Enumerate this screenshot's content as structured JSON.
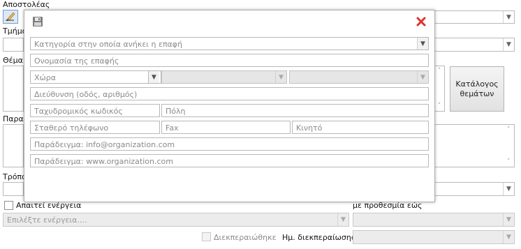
{
  "background_form": {
    "sender_label": "Αποστολέας",
    "department_label": "Τμήμα",
    "subject_label": "Θέμα",
    "notes_label": "Παρατ",
    "method_label": "Τρόπο",
    "catalog_button": "Κατάλογος θεμάτων",
    "requires_action_label": "Απαιτεί ενέργεια",
    "deadline_label": "με προθεσμία εώς",
    "action_select_placeholder": "Επιλέξτε ενέργεια....",
    "completed_label": "Διεκπεραιώθηκε",
    "completion_date_label": "Ημ. διεκπεραίωσης:"
  },
  "modal": {
    "category_placeholder": "Κατηγορία στην οποία ανήκει η επαφή",
    "contact_name_placeholder": "Ονομασία της επαφής",
    "country_placeholder": "Χώρα",
    "address_placeholder": "Διεύθυνση (οδός, αριθμός)",
    "postal_code_placeholder": "Ταχυδρομικός κωδικός",
    "city_placeholder": "Πόλη",
    "phone_placeholder": "Σταθερό τηλέφωνο",
    "fax_placeholder": "Fax",
    "mobile_placeholder": "Κινητό",
    "email_placeholder": "Παράδειγμα: info@organization.com",
    "website_placeholder": "Παράδειγμα: www.organization.com"
  },
  "icons": {
    "save": "floppy-disk",
    "close": "red-x",
    "edit": "pencil"
  },
  "colors": {
    "close_icon": "#d9342b",
    "disabled_field": "#e6e6e6"
  }
}
